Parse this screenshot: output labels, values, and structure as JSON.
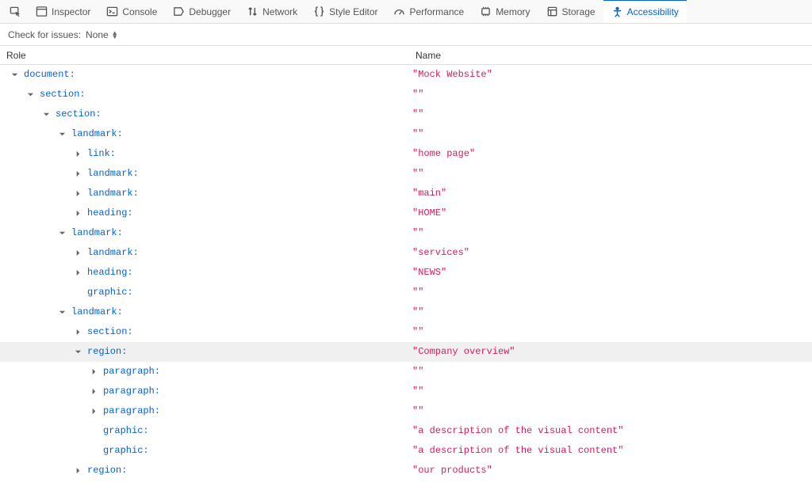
{
  "toolbar": {
    "inspector": "Inspector",
    "console": "Console",
    "debugger": "Debugger",
    "network": "Network",
    "styleeditor": "Style Editor",
    "performance": "Performance",
    "memory": "Memory",
    "storage": "Storage",
    "accessibility": "Accessibility"
  },
  "issues": {
    "label": "Check for issues:",
    "value": "None"
  },
  "columns": {
    "role": "Role",
    "name": "Name"
  },
  "tree": [
    {
      "depth": 0,
      "arrow": "down",
      "role": "document:",
      "name": "\"Mock Website\"",
      "selected": false
    },
    {
      "depth": 1,
      "arrow": "down",
      "role": "section:",
      "name": "\"\"",
      "selected": false
    },
    {
      "depth": 2,
      "arrow": "down",
      "role": "section:",
      "name": "\"\"",
      "selected": false
    },
    {
      "depth": 3,
      "arrow": "down",
      "role": "landmark:",
      "name": "\"\"",
      "selected": false
    },
    {
      "depth": 4,
      "arrow": "right",
      "role": "link:",
      "name": "\"home page\"",
      "selected": false
    },
    {
      "depth": 4,
      "arrow": "right",
      "role": "landmark:",
      "name": "\"\"",
      "selected": false
    },
    {
      "depth": 4,
      "arrow": "right",
      "role": "landmark:",
      "name": "\"main\"",
      "selected": false
    },
    {
      "depth": 4,
      "arrow": "right",
      "role": "heading:",
      "name": "\"HOME\"",
      "selected": false
    },
    {
      "depth": 3,
      "arrow": "down",
      "role": "landmark:",
      "name": "\"\"",
      "selected": false
    },
    {
      "depth": 4,
      "arrow": "right",
      "role": "landmark:",
      "name": "\"services\"",
      "selected": false
    },
    {
      "depth": 4,
      "arrow": "right",
      "role": "heading:",
      "name": "\"NEWS\"",
      "selected": false
    },
    {
      "depth": 4,
      "arrow": "none",
      "role": "graphic:",
      "name": "\"\"",
      "selected": false
    },
    {
      "depth": 3,
      "arrow": "down",
      "role": "landmark:",
      "name": "\"\"",
      "selected": false
    },
    {
      "depth": 4,
      "arrow": "right",
      "role": "section:",
      "name": "\"\"",
      "selected": false
    },
    {
      "depth": 4,
      "arrow": "down",
      "role": "region:",
      "name": "\"Company overview\"",
      "selected": true
    },
    {
      "depth": 5,
      "arrow": "right",
      "role": "paragraph:",
      "name": "\"\"",
      "selected": false
    },
    {
      "depth": 5,
      "arrow": "right",
      "role": "paragraph:",
      "name": "\"\"",
      "selected": false
    },
    {
      "depth": 5,
      "arrow": "right",
      "role": "paragraph:",
      "name": "\"\"",
      "selected": false
    },
    {
      "depth": 5,
      "arrow": "none",
      "role": "graphic:",
      "name": "\"a description of the visual content\"",
      "selected": false
    },
    {
      "depth": 5,
      "arrow": "none",
      "role": "graphic:",
      "name": "\"a description of the visual content\"",
      "selected": false
    },
    {
      "depth": 4,
      "arrow": "right",
      "role": "region:",
      "name": "\"our products\"",
      "selected": false
    }
  ]
}
